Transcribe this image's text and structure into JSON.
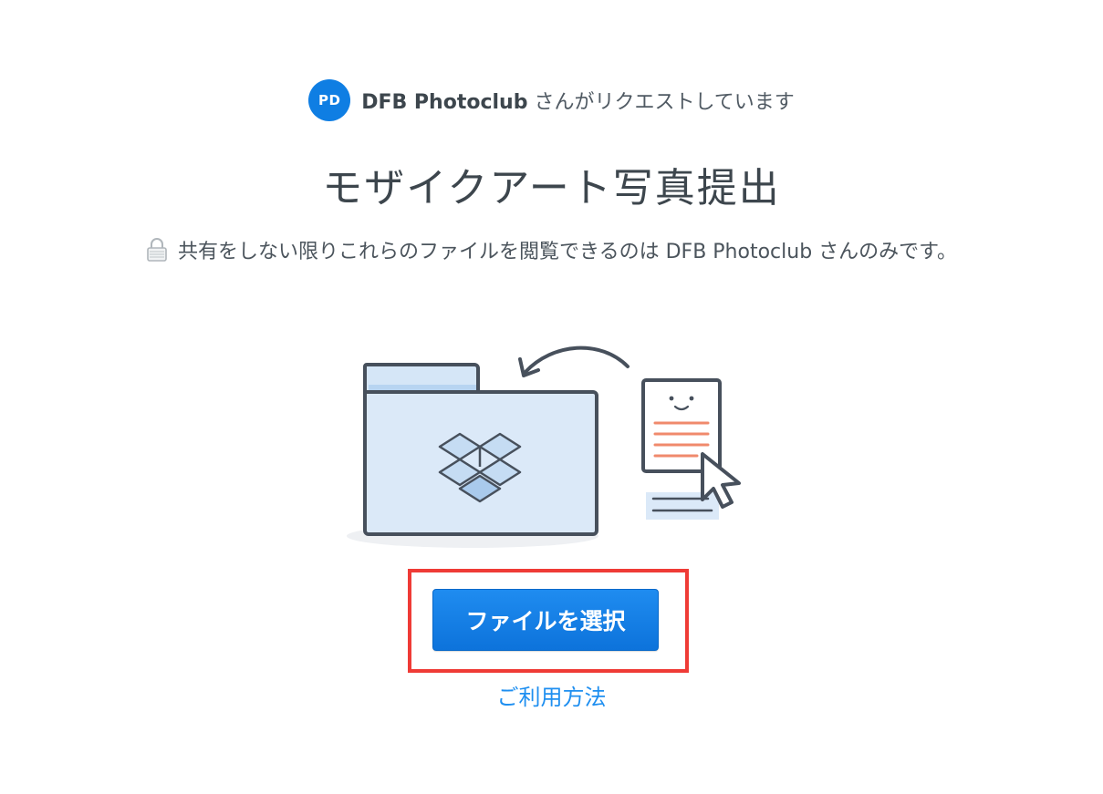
{
  "requester": {
    "avatar_initials": "PD",
    "name": "DFB Photoclub",
    "suffix": " さんがリクエストしています"
  },
  "title": "モザイクアート写真提出",
  "privacy": {
    "icon": "lock-icon",
    "text": "共有をしない限りこれらのファイルを閲覧できるのは DFB Photoclub さんのみです。"
  },
  "illustration": {
    "icons": [
      "folder-icon",
      "dropbox-logo",
      "document-icon",
      "cursor-icon",
      "arrow-icon"
    ]
  },
  "actions": {
    "choose_files_label": "ファイルを選択",
    "help_link_label": "ご利用方法"
  },
  "colors": {
    "accent": "#0f7ee3",
    "button": "#1481e8",
    "link": "#1f8ff0",
    "highlight": "#ef3b36"
  }
}
